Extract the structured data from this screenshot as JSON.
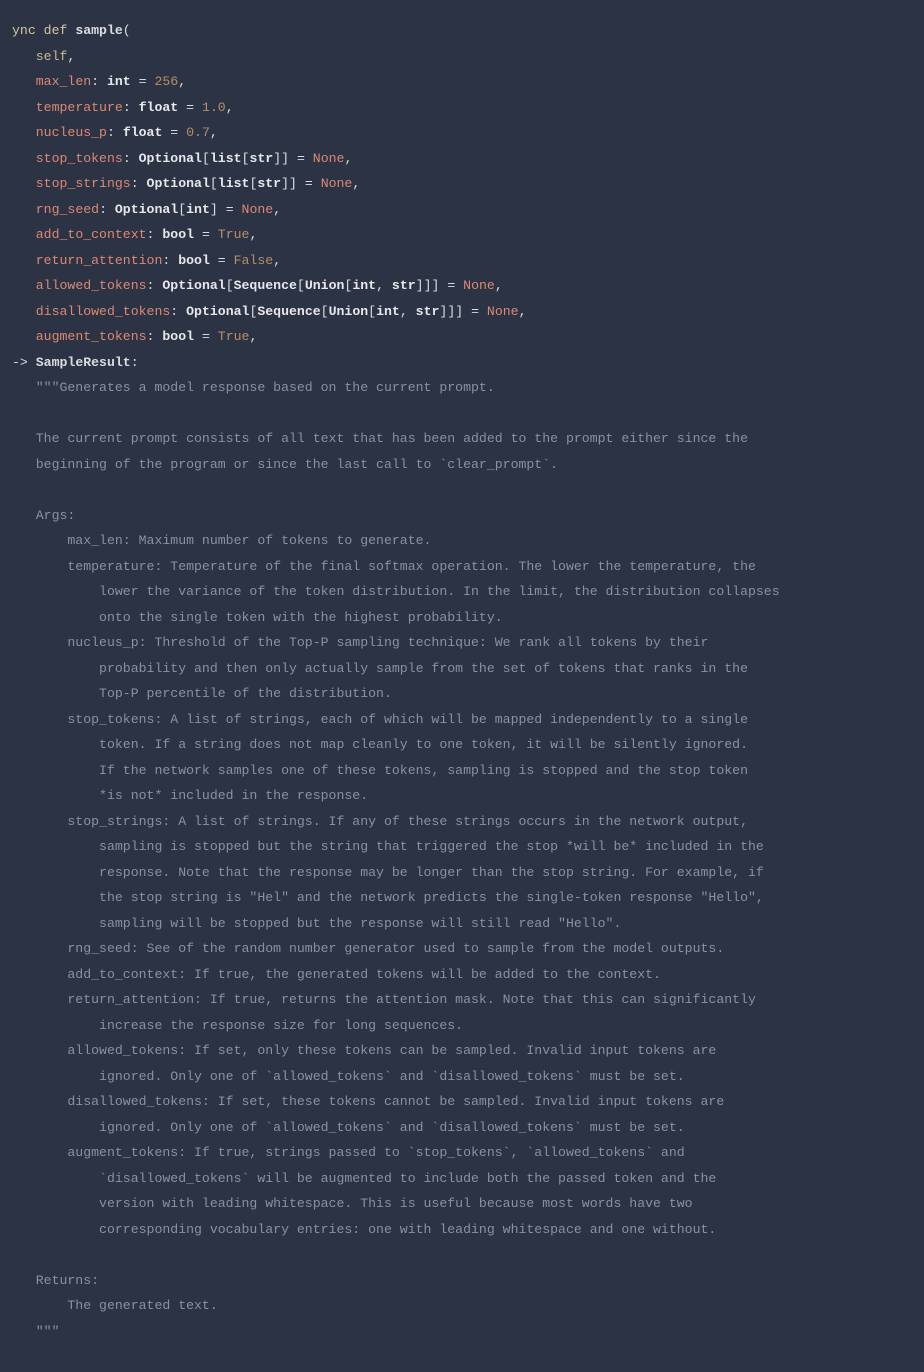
{
  "code": {
    "l1": {
      "kw": "ync def ",
      "fn": "sample",
      "p": "("
    },
    "l2": {
      "self": "self",
      "c": ","
    },
    "l3": {
      "name": "max_len",
      "colon": ": ",
      "type": "int",
      "eq": " = ",
      "val": "256",
      "c": ","
    },
    "l4": {
      "name": "temperature",
      "colon": ": ",
      "type": "float",
      "eq": " = ",
      "val": "1.0",
      "c": ","
    },
    "l5": {
      "name": "nucleus_p",
      "colon": ": ",
      "type": "float",
      "eq": " = ",
      "val": "0.7",
      "c": ","
    },
    "l6": {
      "name": "stop_tokens",
      "colon": ": ",
      "t1": "Optional",
      "b1": "[",
      "t2": "list",
      "b2": "[",
      "t3": "str",
      "b3": "]] = ",
      "val": "None",
      "c": ","
    },
    "l7": {
      "name": "stop_strings",
      "colon": ": ",
      "t1": "Optional",
      "b1": "[",
      "t2": "list",
      "b2": "[",
      "t3": "str",
      "b3": "]] = ",
      "val": "None",
      "c": ","
    },
    "l8": {
      "name": "rng_seed",
      "colon": ": ",
      "t1": "Optional",
      "b1": "[",
      "t2": "int",
      "b2": "] = ",
      "val": "None",
      "c": ","
    },
    "l9": {
      "name": "add_to_context",
      "colon": ": ",
      "type": "bool",
      "eq": " = ",
      "val": "True",
      "c": ","
    },
    "l10": {
      "name": "return_attention",
      "colon": ": ",
      "type": "bool",
      "eq": " = ",
      "val": "False",
      "c": ","
    },
    "l11": {
      "name": "allowed_tokens",
      "colon": ": ",
      "t1": "Optional",
      "b1": "[",
      "t2": "Sequence",
      "b2": "[",
      "t3": "Union",
      "b3": "[",
      "t4": "int",
      "sep": ", ",
      "t5": "str",
      "b4": "]]] = ",
      "val": "None",
      "c": ","
    },
    "l12": {
      "name": "disallowed_tokens",
      "colon": ": ",
      "t1": "Optional",
      "b1": "[",
      "t2": "Sequence",
      "b2": "[",
      "t3": "Union",
      "b3": "[",
      "t4": "int",
      "sep": ", ",
      "t5": "str",
      "b4": "]]] = ",
      "val": "None",
      "c": ","
    },
    "l13": {
      "name": "augment_tokens",
      "colon": ": ",
      "type": "bool",
      "eq": " = ",
      "val": "True",
      "c": ","
    },
    "l14": {
      "arrow": "-> ",
      "ret": "SampleResult",
      "colon": ":"
    },
    "doc": {
      "q1": "   \"\"\"",
      "d0": "Generates a model response based on the current prompt.",
      "blank1": "",
      "d1": "   The current prompt consists of all text that has been added to the prompt either since the",
      "d2": "   beginning of the program or since the last call to `clear_prompt`.",
      "blank2": "",
      "args": "   Args:",
      "a1": "       max_len: Maximum number of tokens to generate.",
      "a2": "       temperature: Temperature of the final softmax operation. The lower the temperature, the",
      "a2b": "           lower the variance of the token distribution. In the limit, the distribution collapses",
      "a2c": "           onto the single token with the highest probability.",
      "a3": "       nucleus_p: Threshold of the Top-P sampling technique: We rank all tokens by their",
      "a3b": "           probability and then only actually sample from the set of tokens that ranks in the",
      "a3c": "           Top-P percentile of the distribution.",
      "a4": "       stop_tokens: A list of strings, each of which will be mapped independently to a single",
      "a4b": "           token. If a string does not map cleanly to one token, it will be silently ignored.",
      "a4c": "           If the network samples one of these tokens, sampling is stopped and the stop token",
      "a4d": "           *is not* included in the response.",
      "a5": "       stop_strings: A list of strings. If any of these strings occurs in the network output,",
      "a5b": "           sampling is stopped but the string that triggered the stop *will be* included in the",
      "a5c": "           response. Note that the response may be longer than the stop string. For example, if",
      "a5d": "           the stop string is \"Hel\" and the network predicts the single-token response \"Hello\",",
      "a5e": "           sampling will be stopped but the response will still read \"Hello\".",
      "a6": "       rng_seed: See of the random number generator used to sample from the model outputs.",
      "a7": "       add_to_context: If true, the generated tokens will be added to the context.",
      "a8": "       return_attention: If true, returns the attention mask. Note that this can significantly",
      "a8b": "           increase the response size for long sequences.",
      "a9": "       allowed_tokens: If set, only these tokens can be sampled. Invalid input tokens are",
      "a9b": "           ignored. Only one of `allowed_tokens` and `disallowed_tokens` must be set.",
      "a10": "       disallowed_tokens: If set, these tokens cannot be sampled. Invalid input tokens are",
      "a10b": "           ignored. Only one of `allowed_tokens` and `disallowed_tokens` must be set.",
      "a11": "       augment_tokens: If true, strings passed to `stop_tokens`, `allowed_tokens` and",
      "a11b": "           `disallowed_tokens` will be augmented to include both the passed token and the",
      "a11c": "           version with leading whitespace. This is useful because most words have two",
      "a11d": "           corresponding vocabulary entries: one with leading whitespace and one without.",
      "blank3": "",
      "ret": "   Returns:",
      "r1": "       The generated text.",
      "q2": "   \"\"\""
    }
  }
}
